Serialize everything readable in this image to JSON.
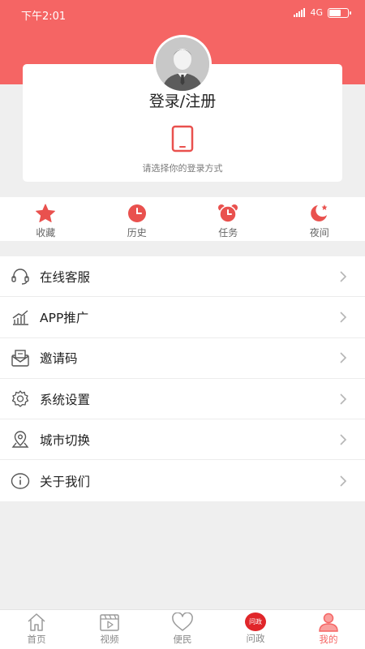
{
  "status_bar": {
    "time": "下午2:01",
    "network": "4G"
  },
  "profile": {
    "login_title": "登录/注册",
    "login_hint": "请选择你的登录方式"
  },
  "quick_actions": [
    {
      "label": "收藏",
      "icon": "star-icon"
    },
    {
      "label": "历史",
      "icon": "clock-icon"
    },
    {
      "label": "任务",
      "icon": "alarm-clock-icon"
    },
    {
      "label": "夜间",
      "icon": "moon-icon"
    }
  ],
  "menu": [
    {
      "label": "在线客服",
      "icon": "headset-icon"
    },
    {
      "label": "APP推广",
      "icon": "chart-icon"
    },
    {
      "label": "邀请码",
      "icon": "envelope-icon"
    },
    {
      "label": "系统设置",
      "icon": "gear-icon"
    },
    {
      "label": "城市切换",
      "icon": "location-icon"
    },
    {
      "label": "关于我们",
      "icon": "info-icon"
    }
  ],
  "tabs": [
    {
      "label": "首页",
      "icon": "home-icon"
    },
    {
      "label": "视频",
      "icon": "video-icon"
    },
    {
      "label": "便民",
      "icon": "heart-icon"
    },
    {
      "label": "问政",
      "icon": "wenzheng-badge-icon",
      "badge_text": "问政"
    },
    {
      "label": "我的",
      "icon": "user-icon",
      "active": true
    }
  ],
  "colors": {
    "accent": "#f56564",
    "quick_icon": "#e9514e",
    "background": "#efefef"
  }
}
